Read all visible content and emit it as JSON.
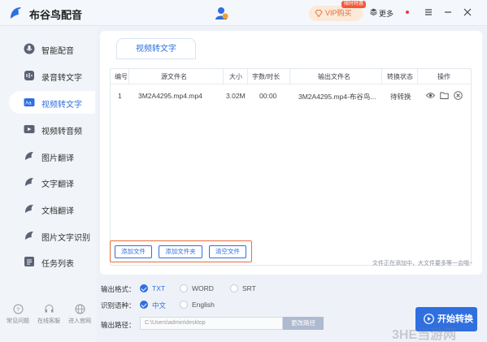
{
  "app": {
    "title": "布谷鸟配音"
  },
  "header": {
    "vip_label": "VIP购买",
    "vip_badge": "限时特惠",
    "more_label": "更多"
  },
  "sidebar": {
    "items": [
      {
        "label": "智能配音",
        "icon": "mic-icon"
      },
      {
        "label": "录音转文字",
        "icon": "record-icon"
      },
      {
        "label": "视频转文字",
        "icon": "video-text-icon",
        "active": true
      },
      {
        "label": "视频转音频",
        "icon": "video-audio-icon"
      },
      {
        "label": "图片翻译",
        "icon": "image-translate-icon"
      },
      {
        "label": "文字翻译",
        "icon": "text-translate-icon"
      },
      {
        "label": "文档翻译",
        "icon": "doc-translate-icon"
      },
      {
        "label": "图片文字识别",
        "icon": "ocr-icon"
      },
      {
        "label": "任务列表",
        "icon": "task-list-icon"
      }
    ],
    "bottom_links": [
      "常见问题",
      "在线客服",
      "进入官网"
    ]
  },
  "main": {
    "tab": "视频转文字",
    "table": {
      "headers": [
        "编号",
        "源文件名",
        "大小",
        "字数/时长",
        "输出文件名",
        "转换状态",
        "操作"
      ],
      "rows": [
        {
          "no": "1",
          "source": "3M2A4295.mp4.mp4",
          "size": "3.02M",
          "duration": "00:00",
          "output": "3M2A4295.mp4-布谷鸟...",
          "status": "待转换"
        }
      ]
    },
    "buttons": {
      "add_file": "添加文件",
      "add_folder": "添加文件夹",
      "clear_files": "清空文件"
    },
    "hint": "文件正在添加中，大文件要多等一会哦~"
  },
  "settings": {
    "format_label": "输出格式：",
    "formats": [
      "TXT",
      "WORD",
      "SRT"
    ],
    "selected_format": "TXT",
    "language_label": "识别语种：",
    "languages": [
      "中文",
      "English"
    ],
    "selected_language": "中文",
    "path_label": "输出路径：",
    "path_value": "C:\\Users\\admin\\desktop",
    "change_path": "更改路径",
    "start_button": "开始转换"
  },
  "watermark": "3HE当游网",
  "colors": {
    "accent": "#2f6fe0",
    "highlight_border": "#e86e3c",
    "vip_text": "#d9733a"
  }
}
